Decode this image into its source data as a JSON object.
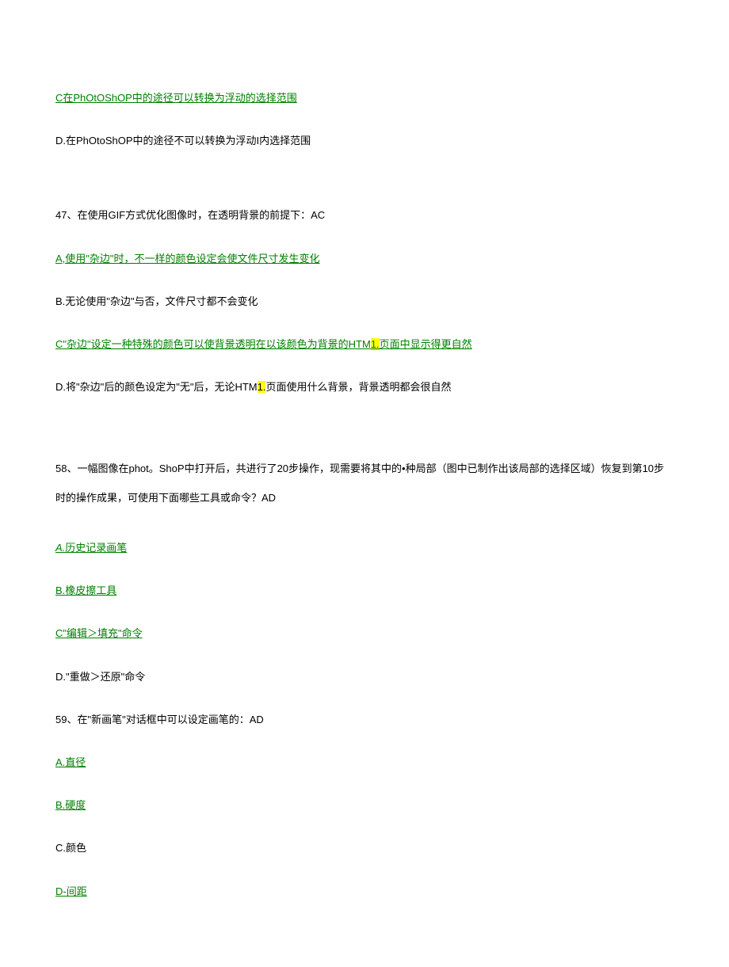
{
  "q46": {
    "optC": "C在PhOtOShOP中的途径可以转换为浮动的选择范围",
    "optD": "D.在PhOtoShOP中的途径不可以转换为浮动I内选择范围"
  },
  "q47": {
    "stem": "47、在使用GIF方式优化图像时，在透明背景的前提下：AC",
    "optA": "A,使用\"杂边\"时，不一样的颜色设定会使文件尺寸发生变化",
    "optB": "B.无论使用\"杂边\"与否，文件尺寸都不会变化",
    "optC_pre": "C\"杂边\"设定一种特殊的颜色可以使背景透明在以该颜色为背景的HTM",
    "optC_hl": "1.",
    "optC_post": "页面中显示得更自然",
    "optD_pre": "D.将\"杂边\"后的颜色设定为\"无\"后，无论HTM",
    "optD_hl": "1.",
    "optD_post": "页面使用什么背景，背景透明都会很自然"
  },
  "q58": {
    "stem": "58、一幅图像在phot。ShoP中打开后，共进行了20步操作，现需要将其中的•种局部（图中已制作出该局部的选择区域）恢复到第10步时的操作成果，可使用下面哪些工具或命令？AD",
    "optA_pre": "A.",
    "optA": "历史记录画笔",
    "optB": "B.橡皮擦工具",
    "optC": "C\"编辑＞填充\"命令",
    "optD": "D.\"重做＞还原\"命令"
  },
  "q59": {
    "stem": "59、在\"新画笔\"对话框中可以设定画笔的：AD",
    "optA": "A.直径",
    "optB": "B.硬度",
    "optC": "C.颜色",
    "optD": "D-间距"
  }
}
